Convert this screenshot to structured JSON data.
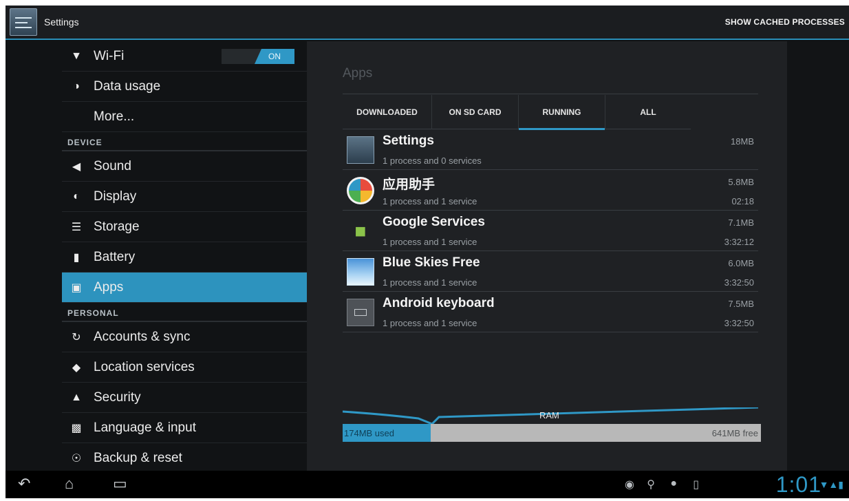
{
  "action_bar": {
    "title": "Settings",
    "cached_label": "SHOW CACHED PROCESSES"
  },
  "sidebar": {
    "wifi": {
      "label": "Wi-Fi",
      "toggle": "ON"
    },
    "data_usage": "Data usage",
    "more": "More...",
    "device_header": "DEVICE",
    "sound": "Sound",
    "display": "Display",
    "storage": "Storage",
    "battery": "Battery",
    "apps": "Apps",
    "personal_header": "PERSONAL",
    "accounts": "Accounts & sync",
    "location": "Location services",
    "security": "Security",
    "language": "Language & input",
    "backup": "Backup & reset"
  },
  "main": {
    "title": "Apps",
    "tabs": {
      "downloaded": "DOWNLOADED",
      "sdcard": "ON SD CARD",
      "running": "RUNNING",
      "all": "ALL"
    },
    "apps": [
      {
        "name": "Settings",
        "desc": "1 process and 0 services",
        "size": "18MB",
        "time": ""
      },
      {
        "name": "应用助手",
        "desc": "1 process and 1 service",
        "size": "5.8MB",
        "time": "02:18"
      },
      {
        "name": "Google Services",
        "desc": "1 process and 1 service",
        "size": "7.1MB",
        "time": "3:32:12"
      },
      {
        "name": "Blue Skies Free",
        "desc": "1 process and 1 service",
        "size": "6.0MB",
        "time": "3:32:50"
      },
      {
        "name": "Android keyboard",
        "desc": "1 process and 1 service",
        "size": "7.5MB",
        "time": "3:32:50"
      }
    ],
    "ram": {
      "title": "RAM",
      "used": "174MB used",
      "free": "641MB free",
      "used_fraction": 0.21
    }
  },
  "status": {
    "clock": "1:01"
  },
  "colors": {
    "accent": "#2f98c6",
    "background": "#101214",
    "panel": "#1f2124"
  }
}
